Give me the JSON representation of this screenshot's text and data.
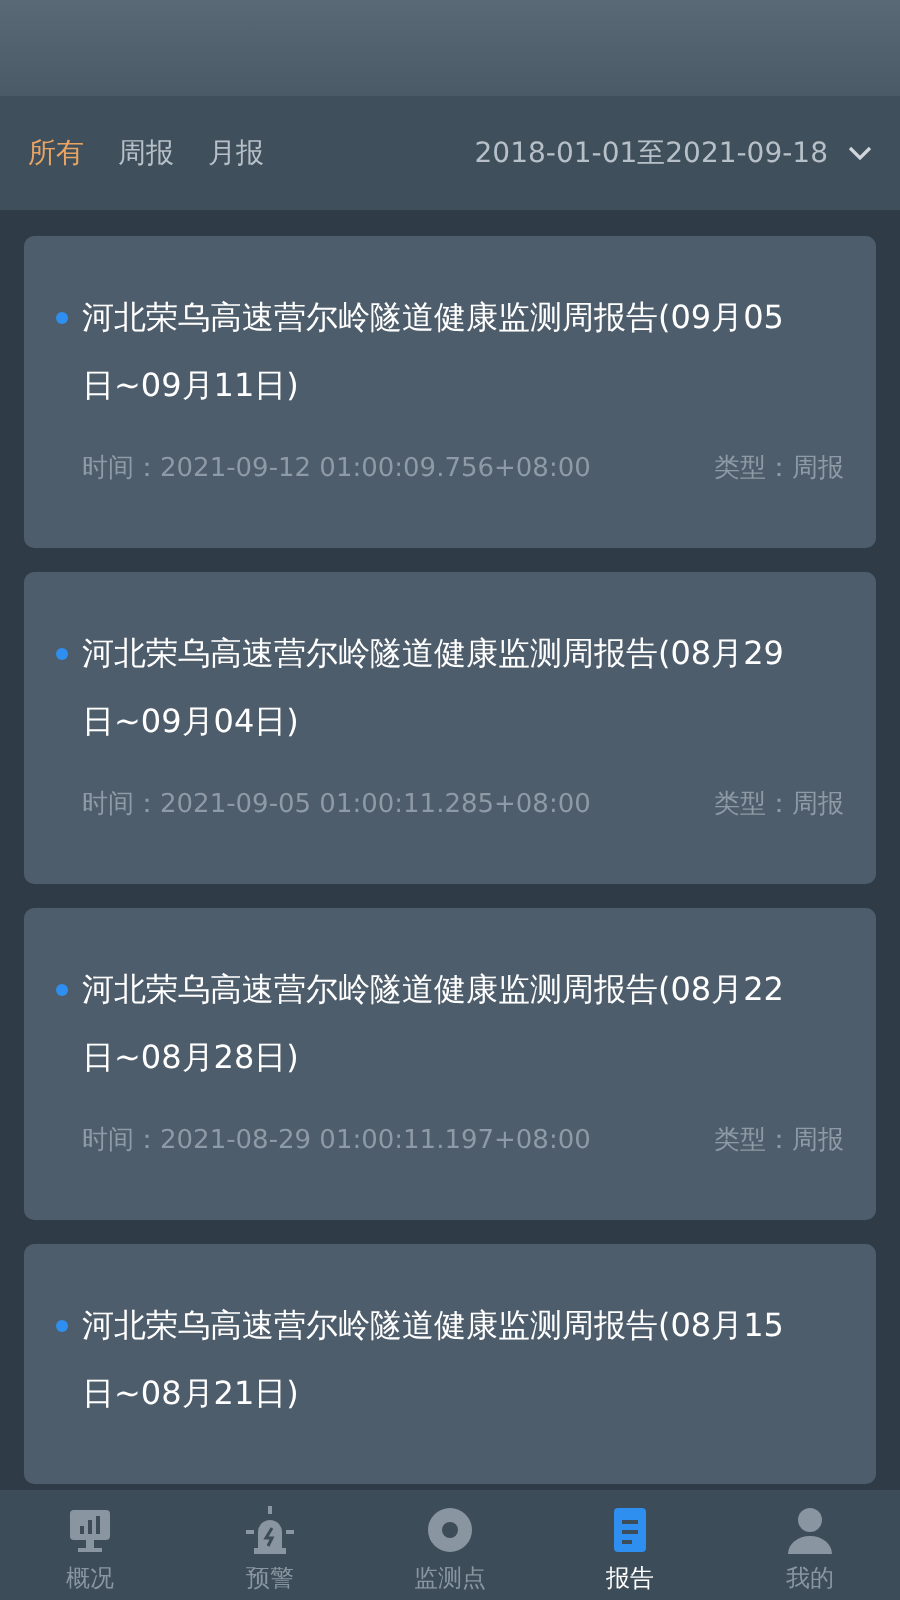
{
  "filter": {
    "tabs": [
      {
        "label": "所有",
        "selected": true
      },
      {
        "label": "周报",
        "selected": false
      },
      {
        "label": "月报",
        "selected": false
      }
    ],
    "date_range": "2018-01-01至2021-09-18"
  },
  "reports": [
    {
      "title": "河北荣乌高速营尔岭隧道健康监测周报告(09月05日~09月11日)",
      "time": "时间：2021-09-12 01:00:09.756+08:00",
      "type": "类型：周报"
    },
    {
      "title": "河北荣乌高速营尔岭隧道健康监测周报告(08月29日~09月04日)",
      "time": "时间：2021-09-05 01:00:11.285+08:00",
      "type": "类型：周报"
    },
    {
      "title": "河北荣乌高速营尔岭隧道健康监测周报告(08月22日~08月28日)",
      "time": "时间：2021-08-29 01:00:11.197+08:00",
      "type": "类型：周报"
    },
    {
      "title": "河北荣乌高速营尔岭隧道健康监测周报告(08月15日~08月21日)"
    }
  ],
  "bottom_nav": [
    {
      "label": "概况",
      "kind": "overview",
      "selected": false
    },
    {
      "label": "预警",
      "kind": "alarm",
      "selected": false
    },
    {
      "label": "监测点",
      "kind": "points",
      "selected": false
    },
    {
      "label": "报告",
      "kind": "report",
      "selected": true
    },
    {
      "label": "我的",
      "kind": "me",
      "selected": false
    }
  ]
}
